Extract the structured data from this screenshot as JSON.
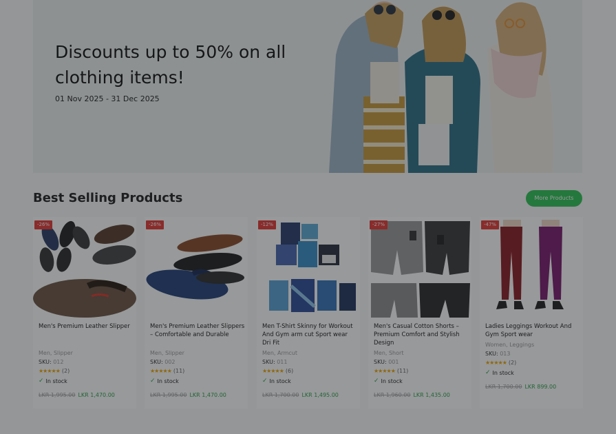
{
  "hero": {
    "title": "Discounts up to 50% on all clothing items!",
    "dates": "01 Nov 2025 - 31 Dec 2025"
  },
  "section": {
    "title": "Best Selling Products",
    "more_button": "More Products"
  },
  "products": [
    {
      "discount": "-26%",
      "name": "Men's Premium Leather Slipper",
      "category": "Men, Slipper",
      "sku_label": "SKU:",
      "sku": "012",
      "stars": "★★★★★",
      "reviews": "(2)",
      "stock": "In stock",
      "old_price": "LKR 1,995.00",
      "new_price": "LKR 1,470.00"
    },
    {
      "discount": "-26%",
      "name": "Men's Premium Leather Slippers – Comfortable and Durable",
      "category": "Men, Slipper",
      "sku_label": "SKU:",
      "sku": "002",
      "stars": "★★★★★",
      "reviews": "(11)",
      "stock": "In stock",
      "old_price": "LKR 1,995.00",
      "new_price": "LKR 1,470.00"
    },
    {
      "discount": "-12%",
      "name": "Men T-Shirt Skinny for Workout And Gym arm cut Sport wear Dri Fit",
      "category": "Men, Armcut",
      "sku_label": "SKU:",
      "sku": "011",
      "stars": "★★★★★",
      "reviews": "(6)",
      "stock": "In stock",
      "old_price": "LKR 1,700.00",
      "new_price": "LKR 1,495.00"
    },
    {
      "discount": "-27%",
      "name": "Men's Casual Cotton Shorts – Premium Comfort and Stylish Design",
      "category": "Men, Short",
      "sku_label": "SKU:",
      "sku": "001",
      "stars": "★★★★★",
      "reviews": "(11)",
      "stock": "In stock",
      "old_price": "LKR 1,960.00",
      "new_price": "LKR 1,435.00"
    },
    {
      "discount": "-47%",
      "name": "Ladies Leggings Workout And Gym Sport wear",
      "category": "Women, Leggings",
      "sku_label": "SKU:",
      "sku": "013",
      "stars": "★★★★★",
      "reviews": "(2)",
      "stock": "In stock",
      "old_price": "LKR 1,700.00",
      "new_price": "LKR 899.00"
    }
  ],
  "colors": {
    "accent": "#31c456",
    "badge": "#e53935",
    "price": "#2e9f4a",
    "star": "#f0a500"
  },
  "icons": {
    "stock": "check-icon",
    "rating": "star-icon"
  }
}
